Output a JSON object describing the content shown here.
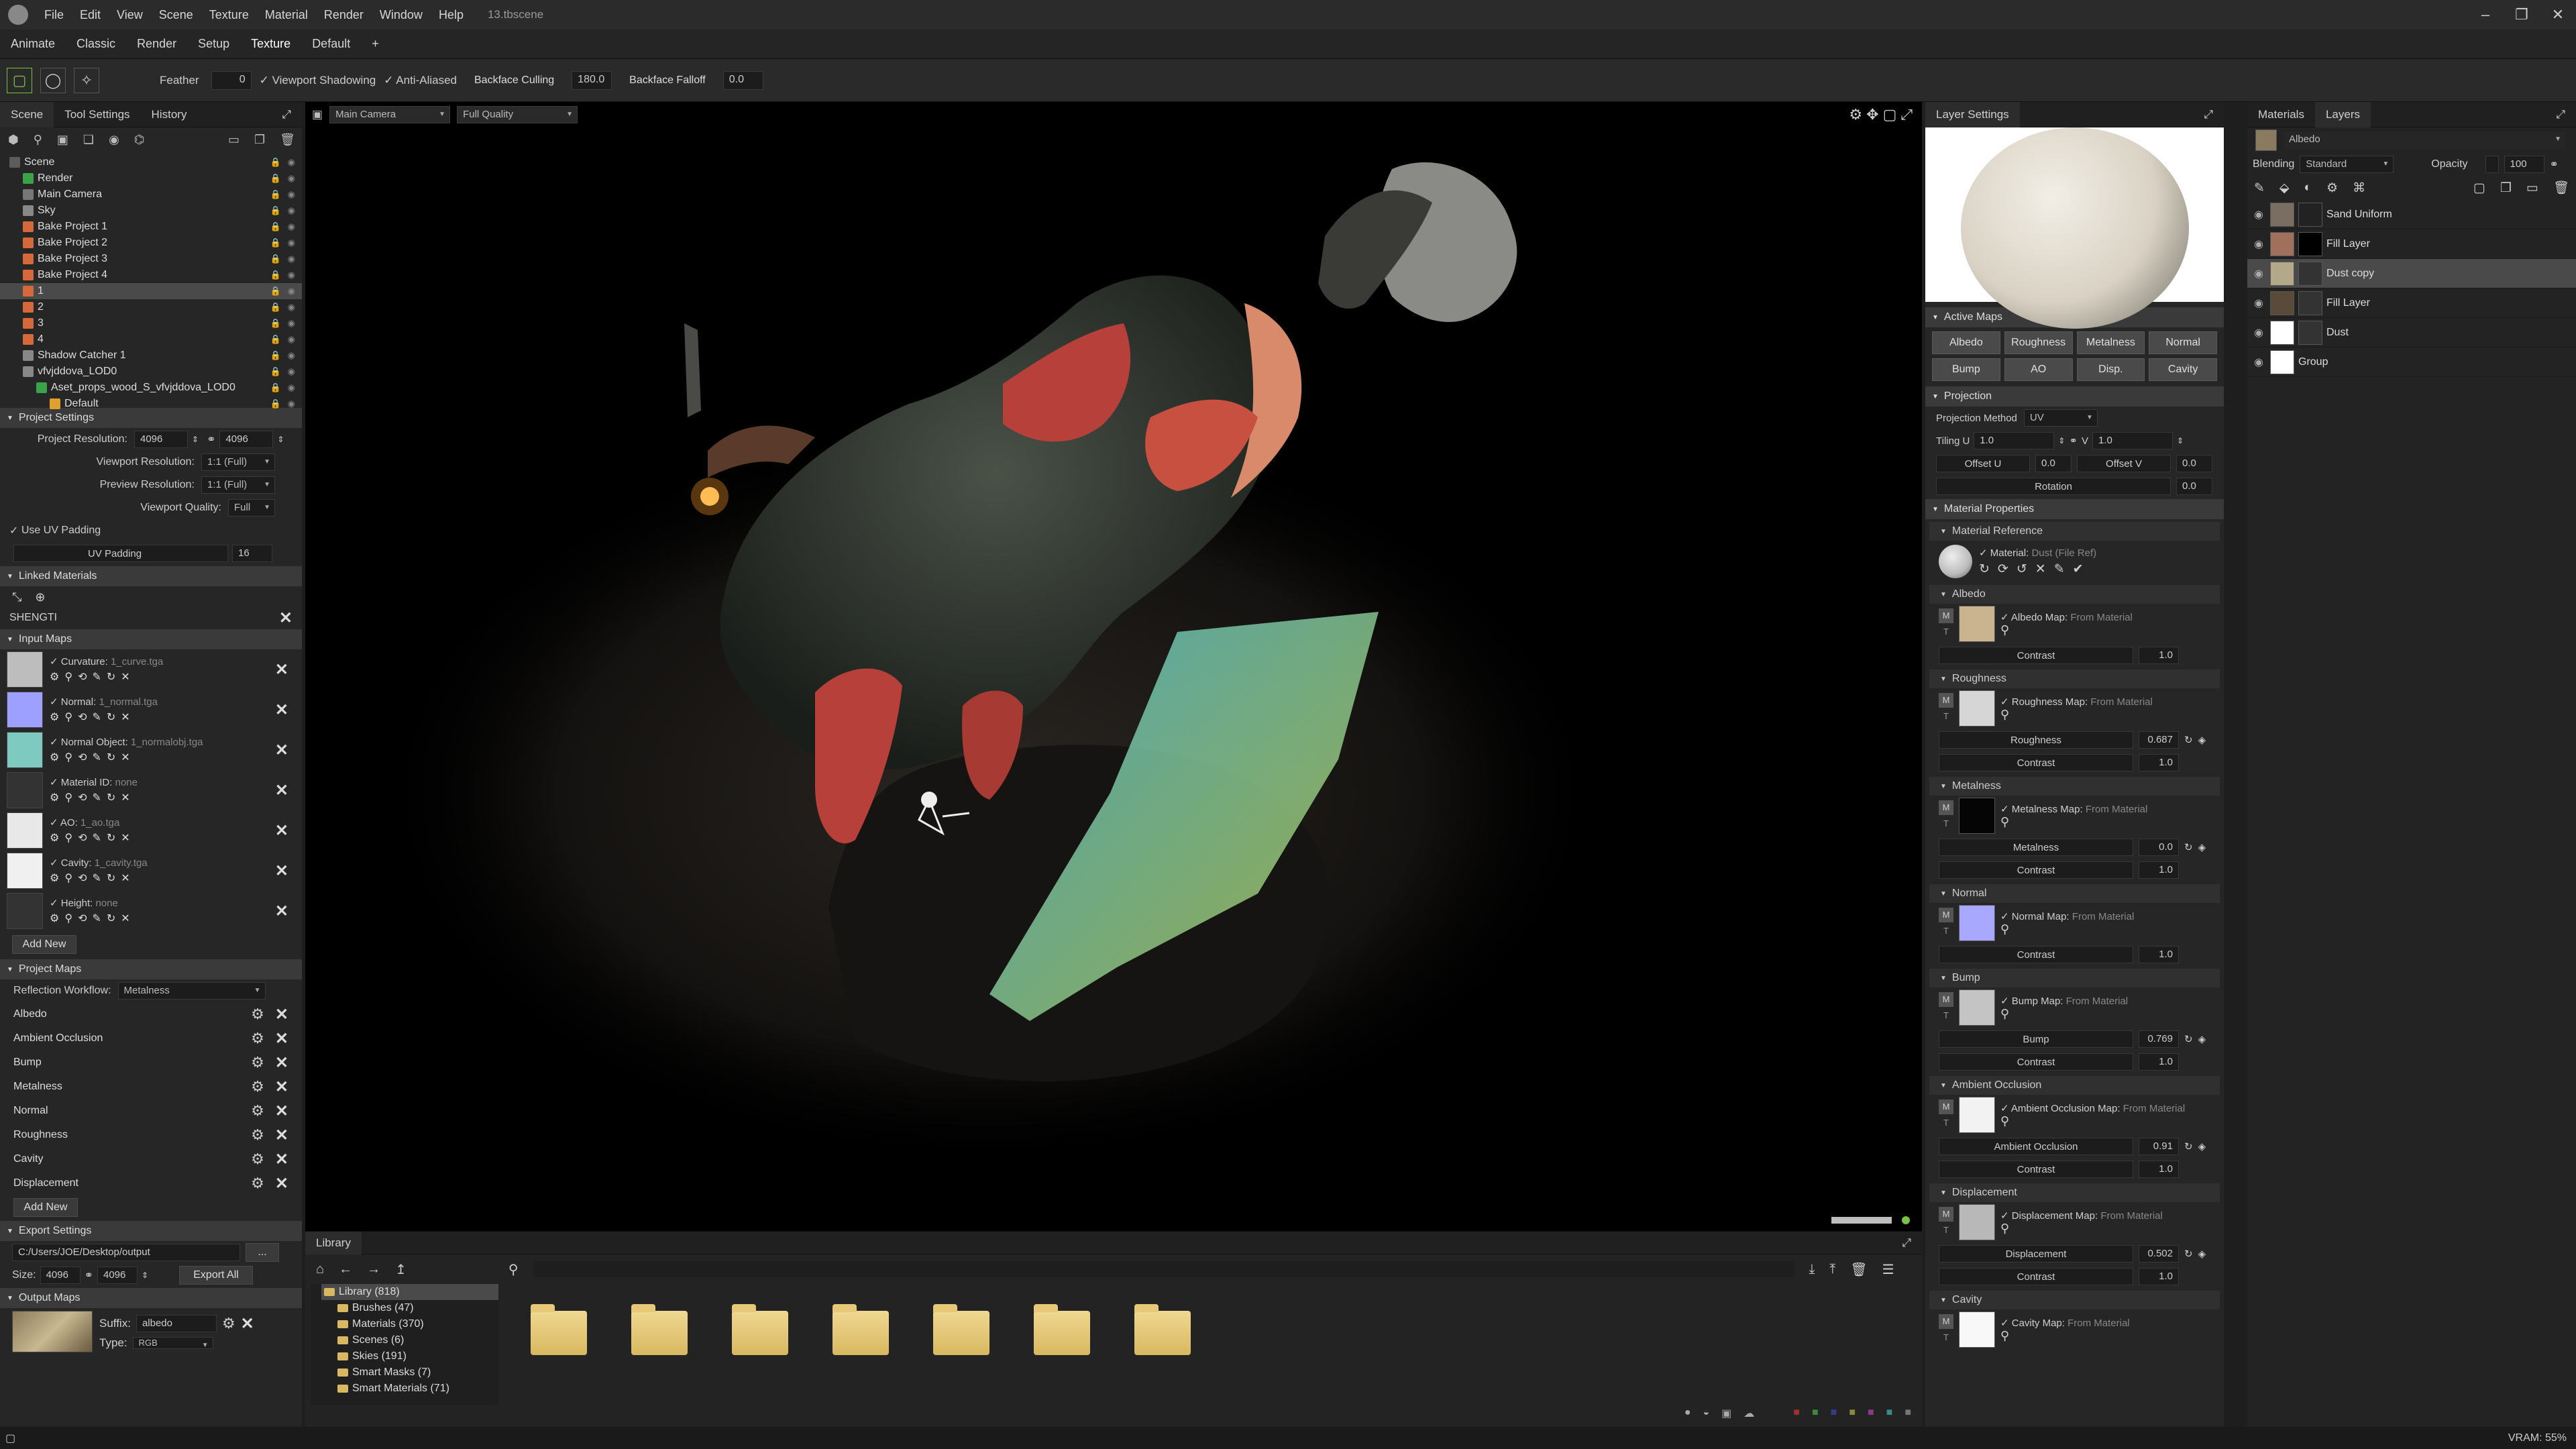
{
  "menu": {
    "items": [
      "File",
      "Edit",
      "View",
      "Scene",
      "Texture",
      "Material",
      "Render",
      "Window",
      "Help"
    ],
    "doc_title": "13.tbscene"
  },
  "modes": [
    "Animate",
    "Classic",
    "Render",
    "Setup",
    "Texture",
    "Default",
    "+"
  ],
  "toolbar": {
    "feather_label": "Feather",
    "feather_value": "0",
    "viewport_shadowing": "Viewport Shadowing",
    "anti_aliased": "Anti-Aliased",
    "backface_culling": "Backface Culling",
    "backface_culling_value": "180.0",
    "backface_falloff": "Backface Falloff",
    "backface_falloff_value": "0.0"
  },
  "left": {
    "tabs": [
      "Scene",
      "Tool Settings",
      "History"
    ],
    "tree": [
      {
        "label": "Scene",
        "indent": 0,
        "color": "#5c5c5c"
      },
      {
        "label": "Render",
        "indent": 1,
        "color": "#3aa34a"
      },
      {
        "label": "Main Camera",
        "indent": 1,
        "color": "#777"
      },
      {
        "label": "Sky",
        "indent": 1,
        "color": "#888"
      },
      {
        "label": "Bake Project 1",
        "indent": 1,
        "color": "#d46a3c"
      },
      {
        "label": "Bake Project 2",
        "indent": 1,
        "color": "#d46a3c"
      },
      {
        "label": "Bake Project 3",
        "indent": 1,
        "color": "#d46a3c"
      },
      {
        "label": "Bake Project 4",
        "indent": 1,
        "color": "#d46a3c"
      },
      {
        "label": "1",
        "indent": 1,
        "color": "#d46a3c",
        "sel": true
      },
      {
        "label": "2",
        "indent": 1,
        "color": "#d46a3c"
      },
      {
        "label": "3",
        "indent": 1,
        "color": "#d46a3c"
      },
      {
        "label": "4",
        "indent": 1,
        "color": "#d46a3c"
      },
      {
        "label": "Shadow Catcher 1",
        "indent": 1,
        "color": "#888"
      },
      {
        "label": "vfvjddova_LOD0",
        "indent": 1,
        "color": "#888"
      },
      {
        "label": "Aset_props_wood_S_vfvjddova_LOD0",
        "indent": 2,
        "color": "#3aa34a"
      },
      {
        "label": "Default",
        "indent": 3,
        "color": "#e0a030"
      }
    ],
    "project_settings": {
      "title": "Project Settings",
      "resolution_label": "Project Resolution:",
      "res_w": "4096",
      "res_h": "4096",
      "viewport_res_label": "Viewport Resolution:",
      "viewport_res": "1:1 (Full)",
      "preview_res_label": "Preview Resolution:",
      "preview_res": "1:1 (Full)",
      "viewport_quality_label": "Viewport Quality:",
      "viewport_quality": "Full",
      "use_uv_padding": "Use UV Padding",
      "uv_padding_label": "UV Padding",
      "uv_padding_value": "16"
    },
    "linked_materials": {
      "title": "Linked Materials",
      "item": "SHENGTI"
    },
    "input_maps": {
      "title": "Input Maps",
      "maps": [
        {
          "label": "Curvature:",
          "file": "1_curve.tga",
          "color": "#bdbdbd"
        },
        {
          "label": "Normal:",
          "file": "1_normal.tga",
          "color": "#9da0ff"
        },
        {
          "label": "Normal Object:",
          "file": "1_normalobj.tga",
          "color": "#7ec9c0"
        },
        {
          "label": "Material ID:",
          "file": "none",
          "color": "#333"
        },
        {
          "label": "AO:",
          "file": "1_ao.tga",
          "color": "#e8e8e8"
        },
        {
          "label": "Cavity:",
          "file": "1_cavity.tga",
          "color": "#f0f0f0"
        },
        {
          "label": "Height:",
          "file": "none",
          "color": "#333"
        }
      ],
      "add_new": "Add New"
    },
    "project_maps": {
      "title": "Project Maps",
      "workflow_label": "Reflection Workflow:",
      "workflow": "Metalness",
      "maps": [
        "Albedo",
        "Ambient Occlusion",
        "Bump",
        "Metalness",
        "Normal",
        "Roughness",
        "Cavity",
        "Displacement"
      ],
      "add_new": "Add New"
    },
    "export_settings": {
      "title": "Export Settings",
      "path": "C:/Users/JOE/Desktop/output",
      "path_btn": "...",
      "size_label": "Size:",
      "w": "4096",
      "h": "4096",
      "export_all": "Export All"
    },
    "output_maps": {
      "title": "Output Maps",
      "suffix_label": "Suffix:",
      "suffix": "albedo",
      "type_label": "Type:",
      "type": "RGB"
    }
  },
  "viewport": {
    "camera": "Main Camera",
    "quality": "Full Quality"
  },
  "library": {
    "tab": "Library",
    "tree": [
      {
        "label": "Library (818)",
        "sel": true
      },
      {
        "label": "Brushes (47)"
      },
      {
        "label": "Materials (370)"
      },
      {
        "label": "Scenes (6)"
      },
      {
        "label": "Skies (191)"
      },
      {
        "label": "Smart Masks (7)"
      },
      {
        "label": "Smart Materials (71)"
      }
    ],
    "folders": 7
  },
  "layer_settings": {
    "tab": "Layer Settings",
    "active_maps": {
      "title": "Active Maps",
      "row1": [
        "Albedo",
        "Roughness",
        "Metalness",
        "Normal"
      ],
      "row2": [
        "Bump",
        "AO",
        "Disp.",
        "Cavity"
      ]
    },
    "projection": {
      "title": "Projection",
      "method_label": "Projection Method",
      "method": "UV",
      "tiling_label": "Tiling U",
      "tiling_u": "1.0",
      "v_label": "V",
      "tiling_v": "1.0",
      "offset_u_label": "Offset U",
      "offset_u": "0.0",
      "offset_v_label": "Offset V",
      "offset_v": "0.0",
      "rotation_label": "Rotation",
      "rotation": "0.0"
    },
    "material_properties": {
      "title": "Material Properties"
    },
    "material_reference": {
      "title": "Material Reference",
      "label": "Material:",
      "value": "Dust (File Ref)"
    },
    "channels": [
      {
        "title": "Albedo",
        "map_label": "Albedo Map:",
        "from": "From Material",
        "swatch": "#c9b48f",
        "params": [
          {
            "label": "Contrast",
            "value": "1.0"
          }
        ]
      },
      {
        "title": "Roughness",
        "map_label": "Roughness Map:",
        "from": "From Material",
        "swatch": "#d6d6d6",
        "params": [
          {
            "label": "Roughness",
            "value": "0.687"
          },
          {
            "label": "Contrast",
            "value": "1.0"
          }
        ]
      },
      {
        "title": "Metalness",
        "map_label": "Metalness Map:",
        "from": "From Material",
        "swatch": "#050505",
        "params": [
          {
            "label": "Metalness",
            "value": "0.0"
          },
          {
            "label": "Contrast",
            "value": "1.0"
          }
        ]
      },
      {
        "title": "Normal",
        "map_label": "Normal Map:",
        "from": "From Material",
        "swatch": "#a8a8ff",
        "params": [
          {
            "label": "Contrast",
            "value": "1.0"
          }
        ]
      },
      {
        "title": "Bump",
        "map_label": "Bump Map:",
        "from": "From Material",
        "swatch": "#c4c4c4",
        "params": [
          {
            "label": "Bump",
            "value": "0.769"
          },
          {
            "label": "Contrast",
            "value": "1.0"
          }
        ]
      },
      {
        "title": "Ambient Occlusion",
        "map_label": "Ambient Occlusion Map:",
        "from": "From Material",
        "swatch": "#f2f2f2",
        "params": [
          {
            "label": "Ambient Occlusion",
            "value": "0.91"
          },
          {
            "label": "Contrast",
            "value": "1.0"
          }
        ]
      },
      {
        "title": "Displacement",
        "map_label": "Displacement Map:",
        "from": "From Material",
        "swatch": "#b8b8b8",
        "params": [
          {
            "label": "Displacement",
            "value": "0.502"
          },
          {
            "label": "Contrast",
            "value": "1.0"
          }
        ]
      },
      {
        "title": "Cavity",
        "map_label": "Cavity Map:",
        "from": "From Material",
        "swatch": "#f8f8f8",
        "params": []
      }
    ]
  },
  "layers": {
    "tabs": [
      "Materials",
      "Layers"
    ],
    "material": "Albedo",
    "blending_label": "Blending",
    "blending": "Standard",
    "opacity_label": "Opacity",
    "opacity": "100",
    "items": [
      {
        "label": "Sand Uniform",
        "thumb": "#7a6e62",
        "mask": "#222"
      },
      {
        "label": "Fill Layer",
        "thumb": "#a0705c",
        "mask": "#000"
      },
      {
        "label": "Dust copy",
        "thumb": "#b4a88a",
        "mask": "#333",
        "sel": true
      },
      {
        "label": "Fill Layer",
        "thumb": "#5a4a3a",
        "mask": "#333"
      },
      {
        "label": "Dust",
        "thumb": "#ffffff",
        "mask": "#333"
      },
      {
        "label": "Group",
        "thumb": "#ffffff",
        "mask": "#000"
      }
    ]
  },
  "status": {
    "vram": "VRAM: 55%"
  },
  "colors": {
    "accent": "#7cc242",
    "panel": "#262626",
    "header": "#3a3a3a"
  }
}
